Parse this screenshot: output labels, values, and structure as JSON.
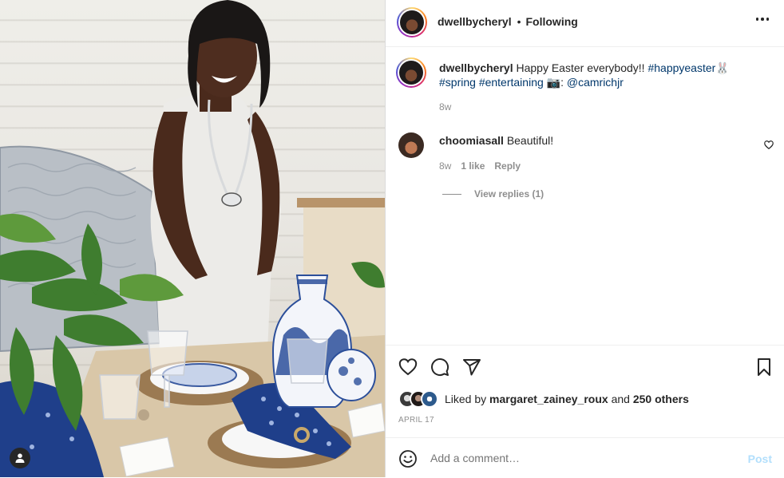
{
  "post": {
    "username": "dwellbycheryl",
    "separator": "•",
    "follow_status": "Following"
  },
  "caption": {
    "username": "dwellbycheryl",
    "text": "Happy Easter everybody!!",
    "hashtag_1": "#happyeaster",
    "emoji_1": "🐰",
    "hashtag_2": "#spring",
    "hashtag_3": "#entertaining",
    "emoji_2": "📷",
    "colon": ":",
    "mention": "@camrichjr",
    "age": "8w"
  },
  "comment": {
    "username": "choomiasall",
    "text": "Beautiful!",
    "age": "8w",
    "likes": "1 like",
    "reply_label": "Reply",
    "view_replies": "View replies (1)"
  },
  "likes": {
    "prefix": "Liked by",
    "user": "margaret_zainey_roux",
    "conj": "and",
    "others": "250 others"
  },
  "date": "APRIL 17",
  "add_comment": {
    "placeholder": "Add a comment…",
    "post_label": "Post"
  },
  "colors": {
    "text": "#262626",
    "secondary": "#8e8e8e",
    "link": "#00376b",
    "post_disabled": "#b2dffc",
    "border": "#efefef"
  },
  "icons": [
    "more-icon",
    "heart-icon",
    "comment-icon",
    "share-icon",
    "bookmark-icon",
    "emoji-icon",
    "user-tag-icon"
  ]
}
